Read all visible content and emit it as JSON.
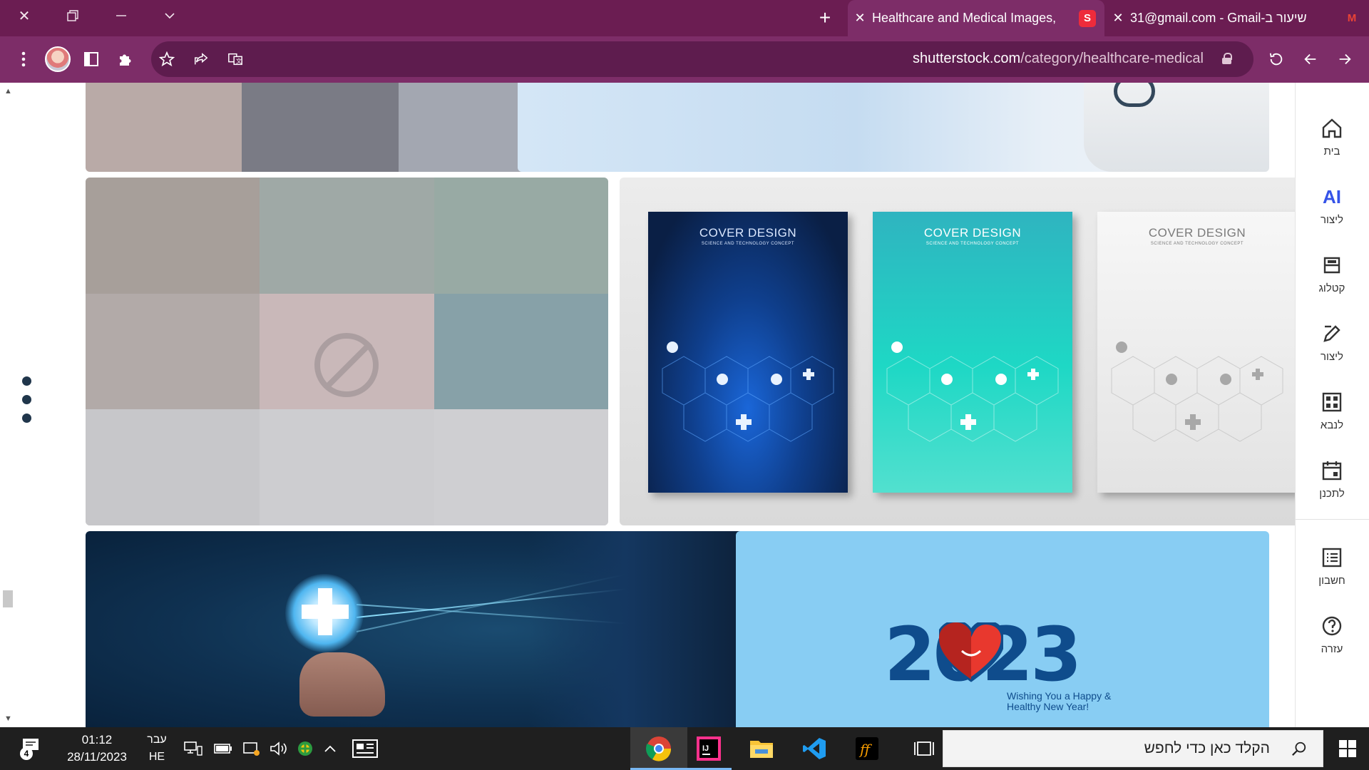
{
  "browser": {
    "tabs": [
      {
        "title": "Healthcare and Medical Images,",
        "favicon": "shutterstock-icon",
        "active": true
      },
      {
        "title": "31@gmail.com - Gmail-שיעור ב",
        "favicon": "gmail-icon",
        "active": false
      }
    ],
    "url_host": "shutterstock.com",
    "url_path": "/category/healthcare-medical"
  },
  "sidebar": {
    "items": [
      {
        "label": "בית",
        "icon": "home-icon"
      },
      {
        "label": "ליצור",
        "icon": "ai-sparkle-icon",
        "icon_text": "AI"
      },
      {
        "label": "קטלוג",
        "icon": "catalog-icon"
      },
      {
        "label": "ליצור",
        "icon": "edit-icon"
      },
      {
        "label": "לנבא",
        "icon": "predict-grid-icon"
      },
      {
        "label": "לתכנן",
        "icon": "calendar-icon"
      },
      {
        "label": "חשבון",
        "icon": "account-list-icon"
      },
      {
        "label": "עזרה",
        "icon": "help-icon"
      }
    ]
  },
  "images": {
    "covers": [
      {
        "title": "COVER DESIGN",
        "subtitle": "SCIENCE AND TECHNOLOGY CONCEPT",
        "theme": "dark-blue"
      },
      {
        "title": "COVER DESIGN",
        "subtitle": "SCIENCE AND TECHNOLOGY CONCEPT",
        "theme": "teal"
      },
      {
        "title": "COVER DESIGN",
        "subtitle": "SCIENCE AND TECHNOLOGY CONCEPT",
        "theme": "white"
      }
    ],
    "new_year": {
      "year": "2023",
      "wish_line1": "Wishing You a Happy &",
      "wish_line2": "Healthy New Year!"
    }
  },
  "taskbar": {
    "search_placeholder": "הקלד כאן כדי לחפש",
    "time": "01:12",
    "date": "28/11/2023",
    "lang_top": "עבר",
    "lang_bottom": "HE",
    "notification_count": "4",
    "apps": [
      "chrome-icon",
      "intellij-icon",
      "file-explorer-icon",
      "vscode-icon",
      "filezilla-icon",
      "task-view-icon"
    ]
  },
  "colors": {
    "tabstrip": "#6b1d52",
    "toolbar": "#7d2d68",
    "taskbar": "#1f1f1f"
  }
}
